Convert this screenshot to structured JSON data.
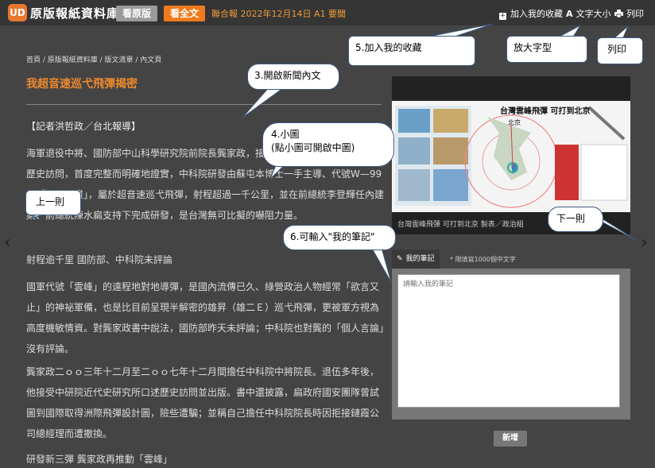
{
  "header": {
    "site_title": "原版報紙資料庫",
    "btn_original": "看原版",
    "btn_fulltext": "看全文",
    "issue": "聯合報 2022年12月14日 A1 要聞",
    "add_favorite": "加入我的收藏",
    "font_size": "文字大小",
    "print": "列印",
    "font_size_icon_glyph": "A"
  },
  "breadcrumb": "首頁 / 原版報紙資料庫 / 版文清單 / 內文頁",
  "article": {
    "title": "我超音速巡弋飛彈揭密",
    "byline": "【記者洪哲政／台北報導】",
    "p1": "海軍退役中將、國防部中山科學研究院前院長龔家政，接受中研院近代史研究所口述歷史訪問，首度完整而明確地證實，中科院研發由蘇屯本博士一手主導、代號W—99的「雲峰計畫」，屬於超音速巡弋飛彈，射程超過一千公里，並在前總統李登輝任內建案、前總統陳水扁支持下完成研發，是台灣無可比擬的嚇阻力量。",
    "heading1": "射程逾千里 國防部、中科院未評論",
    "p2": "國軍代號「雲峰」的遠程地對地導彈，是國內流傳已久、綠營政治人物經常「欲言又止」的神祕軍備，也是比目前呈現半解密的雄昇（雄二Ｅ）巡弋飛彈，更被軍方視為高度機敏情資。對龔家政書中說法，國防部昨天未評論；中科院也對龔的「個人言論」沒有評論。",
    "p3": "龔家政二ｏｏ三年十二月至二ｏｏ七年十二月間擔任中科院中將院長。退伍多年後，他接受中研院近代史研究所口述歷史訪問並出版。書中還披露，扁政府國安團隊曾試圖到國際取得洲際飛彈設計圖，險些遭騙；並稱自己擔任中科院院長時因拒接鏈霞公司總經理而遭撤換。",
    "heading2": "研發新三彈 龔家政再推動「雲峰」"
  },
  "image": {
    "graphic_title": "台灣雲峰飛彈 可打到北京",
    "label_beijing": "北京",
    "caption": "台灣雲峰飛彈 可打到北京 製表／政治組"
  },
  "notes": {
    "tab_label": "我的筆記",
    "hint": "* 限填寫1000個中文字",
    "placeholder": "請輸入我的筆記",
    "add_button": "新增"
  },
  "nav": {
    "prev_glyph": "‹",
    "next_glyph": "›"
  },
  "callouts": {
    "c1": "5.加入我的收藏",
    "c2": "放大字型",
    "c3": "列印",
    "c4": "3.開啟新聞內文",
    "c5_line1": "4.小圖",
    "c5_line2": "(點小圖可開啟中圖)",
    "c6": "上一則",
    "c7": "下一則",
    "c8": "6.可輸入\"我的筆記\""
  },
  "colors": {
    "accent_orange": "#ef7b1c",
    "title_orange": "#ef8a2c",
    "bg_dark": "#444444",
    "topbar": "#353535"
  }
}
